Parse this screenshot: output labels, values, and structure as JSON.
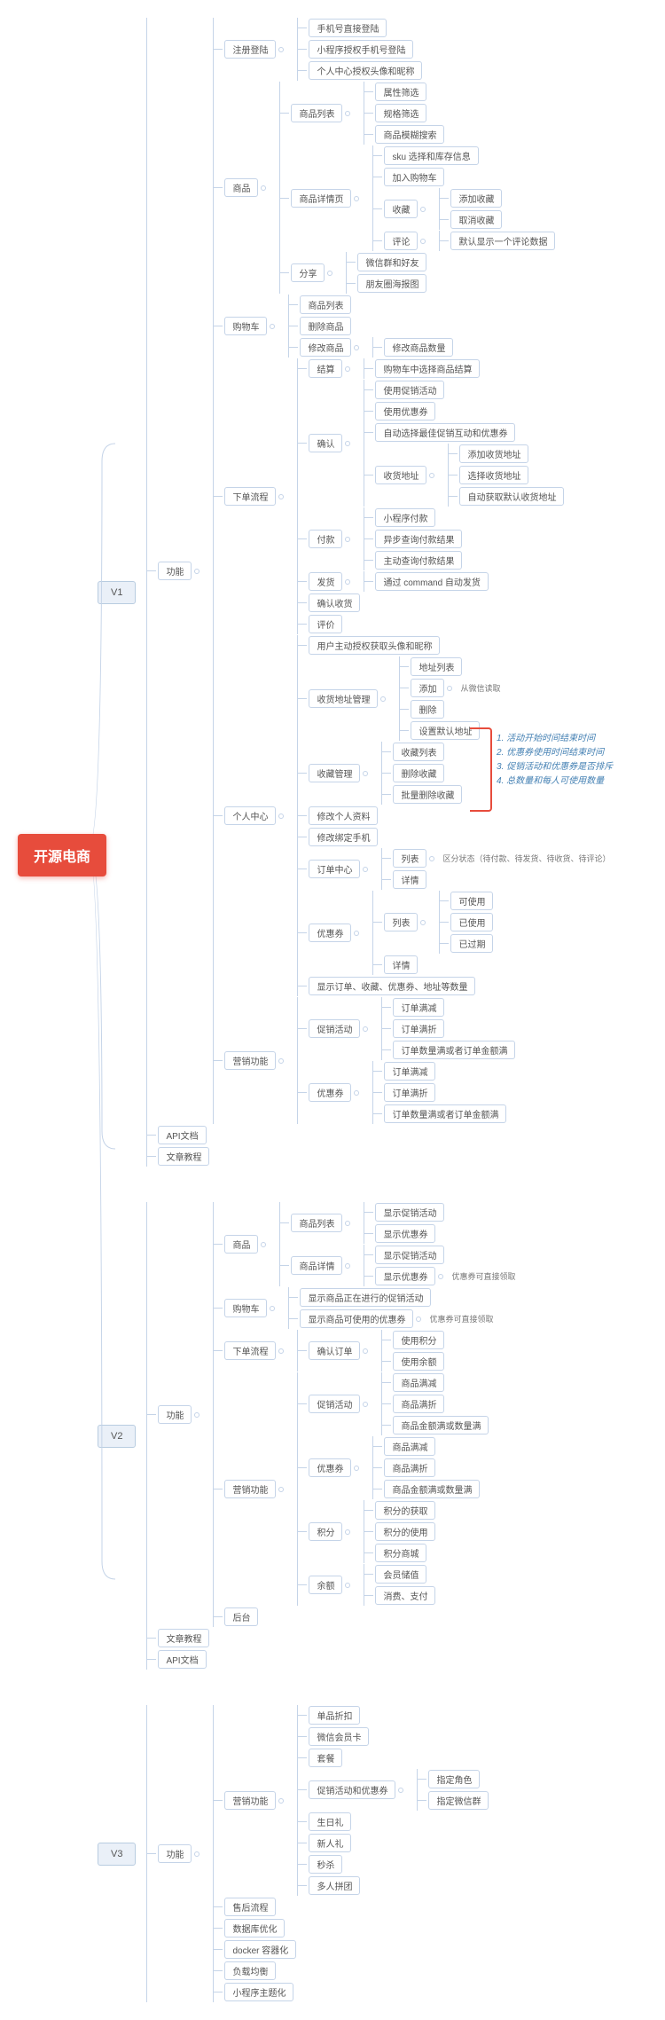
{
  "root": "开源电商",
  "v1": {
    "label": "V1",
    "gongneng": "功能",
    "api": "API文档",
    "tutorial": "文章教程",
    "zhuce": {
      "label": "注册登陆",
      "items": [
        "手机号直接登陆",
        "小程序授权手机号登陆",
        "个人中心授权头像和昵称"
      ]
    },
    "shangpin": {
      "label": "商品",
      "liebiao": {
        "label": "商品列表",
        "items": [
          "属性筛选",
          "规格筛选",
          "商品模糊搜索"
        ]
      },
      "xiangqing": {
        "label": "商品详情页",
        "sku": "sku 选择和库存信息",
        "jiagou": "加入购物车",
        "shoucang": {
          "label": "收藏",
          "items": [
            "添加收藏",
            "取消收藏"
          ]
        },
        "pinglun": {
          "label": "评论",
          "items": [
            "默认显示一个评论数据"
          ]
        }
      },
      "fenxiang": {
        "label": "分享",
        "items": [
          "微信群和好友",
          "朋友圈海报图"
        ]
      }
    },
    "gouwuche": {
      "label": "购物车",
      "list": "商品列表",
      "del": "删除商品",
      "mod": {
        "label": "修改商品",
        "sub": "修改商品数量"
      }
    },
    "xiadan": {
      "label": "下单流程",
      "jiesuan": {
        "label": "结算",
        "sub": "购物车中选择商品结算"
      },
      "queren": {
        "label": "确认",
        "items": [
          "使用促销活动",
          "使用优惠券",
          "自动选择最佳促销互动和优惠券"
        ],
        "shouhuo": {
          "label": "收货地址",
          "items": [
            "添加收货地址",
            "选择收货地址",
            "自动获取默认收货地址"
          ]
        }
      },
      "fukuan": {
        "label": "付款",
        "items": [
          "小程序付款",
          "异步查询付款结果",
          "主动查询付款结果"
        ]
      },
      "fahuo": {
        "label": "发货",
        "sub": "通过 command 自动发货"
      },
      "querenshouhuo": "确认收货",
      "pingjia": "评价"
    },
    "geren": {
      "label": "个人中心",
      "shouquan": "用户主动授权获取头像和昵称",
      "dizhiguanli": {
        "label": "收货地址管理",
        "liebiao": "地址列表",
        "tianjia": {
          "label": "添加",
          "extra": "从微信读取"
        },
        "shanchu": "删除",
        "moren": "设置默认地址"
      },
      "shoucangguanli": {
        "label": "收藏管理",
        "items": [
          "收藏列表",
          "删除收藏",
          "批量删除收藏"
        ]
      },
      "xiugai": "修改个人资料",
      "bangding": "修改绑定手机",
      "dingdan": {
        "label": "订单中心",
        "liebiao": {
          "label": "列表",
          "extra": "区分状态（待付款、待发货、待收货、待评论）"
        },
        "xiangqing": "详情"
      },
      "youhuiquan": {
        "label": "优惠券",
        "liebiao": {
          "label": "列表",
          "items": [
            "可使用",
            "已使用",
            "已过期"
          ]
        },
        "xiangqing": "详情"
      },
      "xianshi": "显示订单、收藏、优惠券、地址等数量"
    },
    "yingxiao": {
      "label": "营销功能",
      "cuxiao": {
        "label": "促销活动",
        "items": [
          "订单满减",
          "订单满折",
          "订单数量满或者订单金额满"
        ]
      },
      "youhuiquan": {
        "label": "优惠券",
        "items": [
          "订单满减",
          "订单满折",
          "订单数量满或者订单金额满"
        ]
      }
    }
  },
  "v2": {
    "label": "V2",
    "gongneng": "功能",
    "tutorial": "文章教程",
    "api": "API文档",
    "shangpin": {
      "label": "商品",
      "liebiao": {
        "label": "商品列表",
        "items": [
          "显示促销活动",
          "显示优惠券"
        ]
      },
      "xiangqing": {
        "label": "商品详情",
        "items": [
          "显示促销活动"
        ],
        "youhui": {
          "label": "显示优惠券",
          "extra": "优惠券可直接领取"
        }
      }
    },
    "gouwuche": {
      "label": "购物车",
      "item1": "显示商品正在进行的促销活动",
      "item2": {
        "label": "显示商品可使用的优惠券",
        "extra": "优惠券可直接领取"
      }
    },
    "xiadan": {
      "label": "下单流程",
      "queren": {
        "label": "确认订单",
        "items": [
          "使用积分",
          "使用余额"
        ]
      }
    },
    "yingxiao": {
      "label": "营销功能",
      "cuxiao": {
        "label": "促销活动",
        "items": [
          "商品满减",
          "商品满折",
          "商品金额满或数量满"
        ]
      },
      "youhuiquan": {
        "label": "优惠券",
        "items": [
          "商品满减",
          "商品满折",
          "商品金额满或数量满"
        ]
      },
      "jifen": {
        "label": "积分",
        "items": [
          "积分的获取",
          "积分的使用",
          "积分商城"
        ]
      },
      "yue": {
        "label": "余额",
        "items": [
          "会员储值",
          "消费、支付"
        ]
      }
    },
    "houtai": "后台"
  },
  "v3": {
    "label": "V3",
    "gongneng": "功能",
    "yingxiao": {
      "label": "营销功能",
      "items": [
        "单品折扣",
        "微信会员卡",
        "套餐"
      ],
      "cuxiao": {
        "label": "促销活动和优惠券",
        "items": [
          "指定角色",
          "指定微信群"
        ]
      },
      "more": [
        "生日礼",
        "新人礼",
        "秒杀",
        "多人拼团"
      ]
    },
    "others": [
      "售后流程",
      "数据库优化",
      "docker 容器化",
      "负载均衡",
      "小程序主题化"
    ]
  },
  "annotations": [
    "1. 活动开始时间结束时间",
    "2. 优惠券使用时间结束时间",
    "3. 促销活动和优惠券是否排斥",
    "4. 总数量和每人可使用数量"
  ]
}
